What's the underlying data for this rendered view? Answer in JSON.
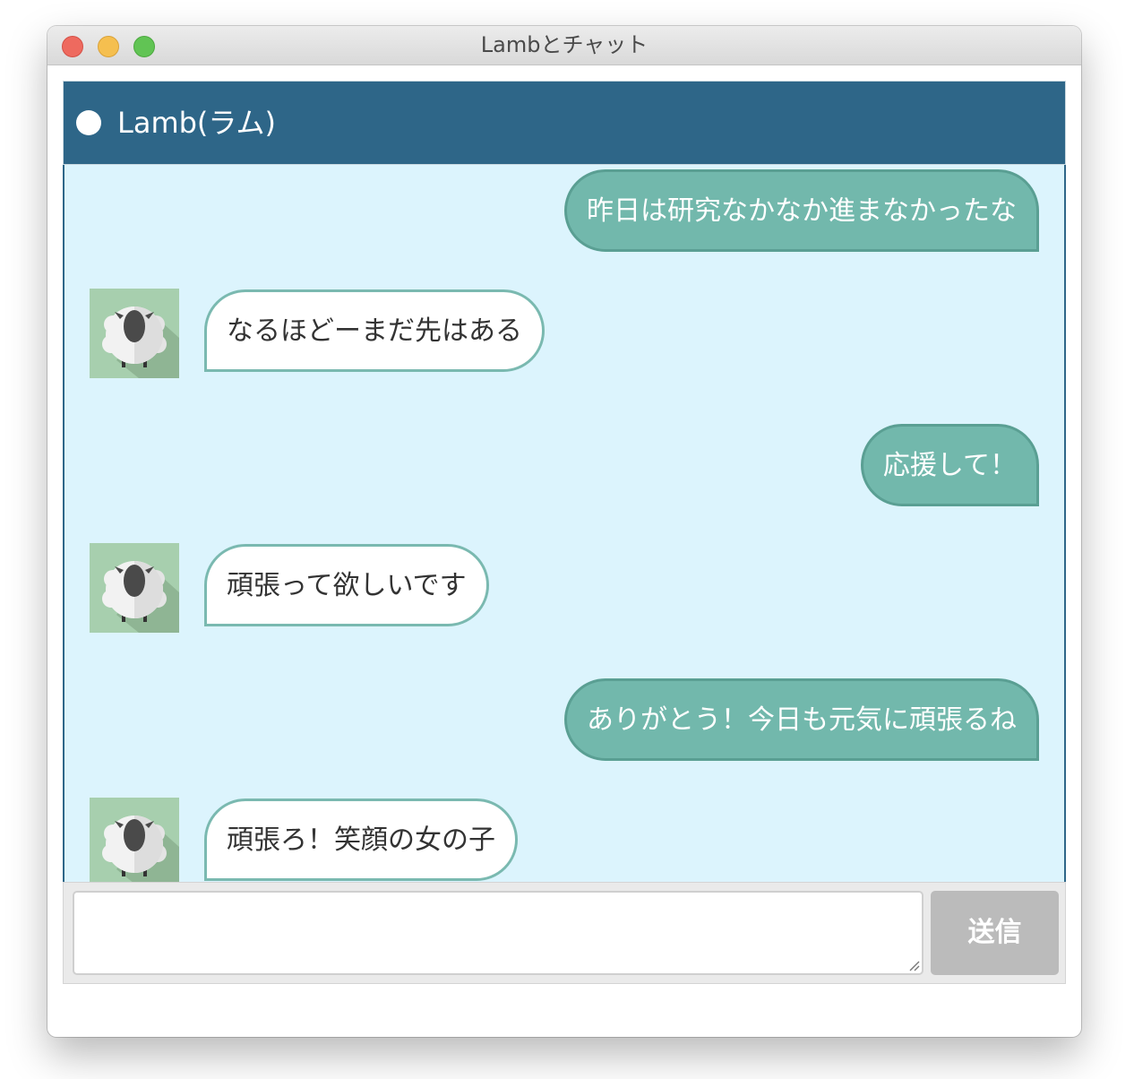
{
  "window": {
    "title": "Lambとチャット"
  },
  "chat": {
    "partner_name": "Lamb(ラム)",
    "status_color": "#ffffff",
    "header_color": "#2e6688",
    "background_color": "#dcf4fd",
    "avatar_icon": "sheep-icon",
    "messages": [
      {
        "sender": "user",
        "text": "昨日は研究なかなか進まなかったな"
      },
      {
        "sender": "lamb",
        "text": "なるほどーまだ先はある"
      },
      {
        "sender": "user",
        "text": "応援して！"
      },
      {
        "sender": "lamb",
        "text": "頑張って欲しいです"
      },
      {
        "sender": "user",
        "text": "ありがとう！今日も元気に頑張るね"
      },
      {
        "sender": "lamb",
        "text": "頑張ろ！笑顔の女の子"
      }
    ]
  },
  "composer": {
    "input_value": "",
    "send_label": "送信",
    "send_color": "#bbbbbb"
  }
}
